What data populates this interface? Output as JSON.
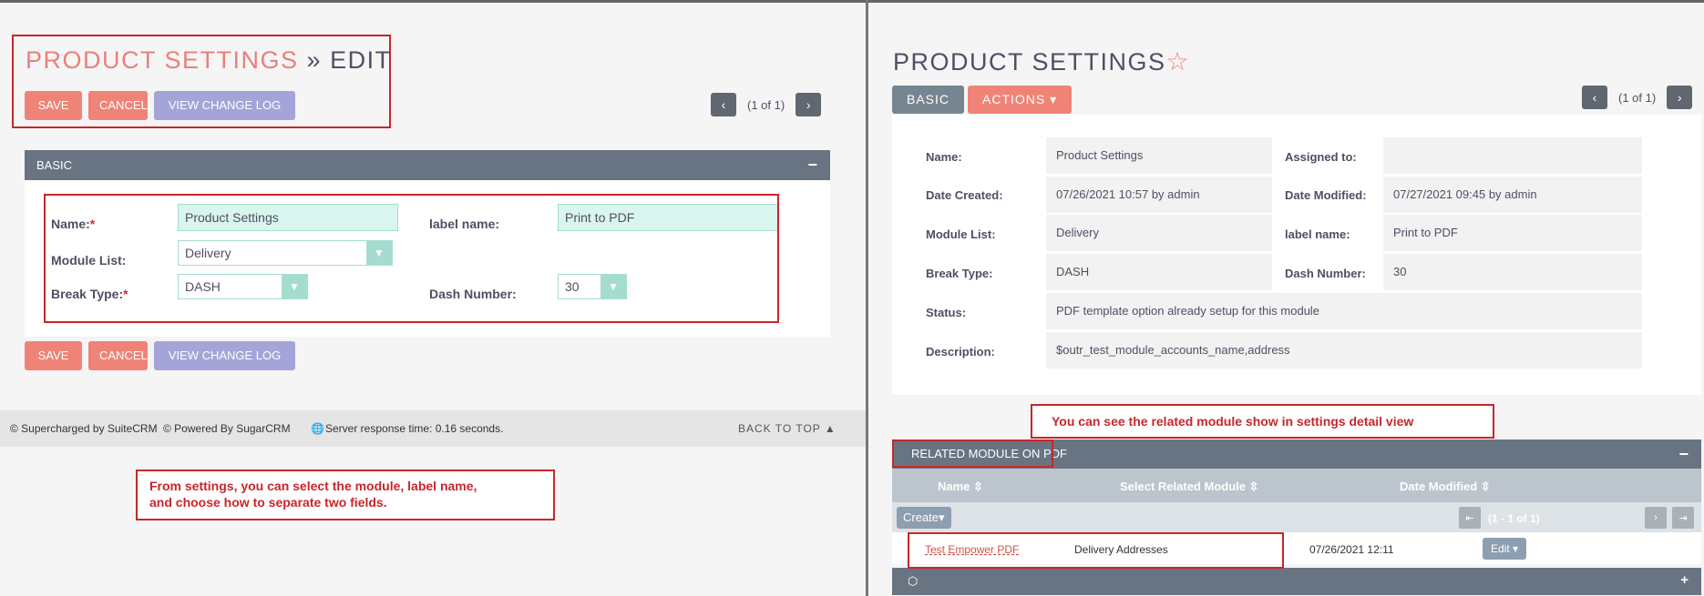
{
  "edit": {
    "title_module": "PRODUCT SETTINGS",
    "title_separator": "»",
    "title_action": "EDIT",
    "buttons": {
      "save": "SAVE",
      "cancel": "CANCEL",
      "change_log": "VIEW CHANGE LOG"
    },
    "pager": {
      "prev": "‹",
      "next": "›",
      "text": "(1 of 1)"
    },
    "panel": {
      "title": "BASIC",
      "toggle": "−"
    },
    "fields": {
      "name_label": "Name:",
      "name_value": "Product Settings",
      "label_name_label": "label name:",
      "label_name_value": "Print to PDF",
      "module_list_label": "Module List:",
      "module_list_value": "Delivery",
      "break_type_label": "Break Type:",
      "break_type_value": "DASH",
      "dash_number_label": "Dash Number:",
      "dash_number_value": "30",
      "required_mark": "*"
    }
  },
  "footer": {
    "suitecrm": "© Supercharged by SuiteCRM",
    "sugarcrm": "© Powered By SugarCRM",
    "server_time": "Server response time: 0.16 seconds.",
    "back_to_top": "BACK TO TOP ▲"
  },
  "note_left": {
    "line1": "From settings, you can select the module, label name,",
    "line2": "and choose how to separate two fields."
  },
  "detail": {
    "title": "PRODUCT SETTINGS",
    "star": "☆",
    "tabs": {
      "basic": "BASIC",
      "actions": "ACTIONS ▾"
    },
    "pager": {
      "prev": "‹",
      "next": "›",
      "text": "(1 of 1)"
    },
    "fields": {
      "name_label": "Name:",
      "name_value": "Product Settings",
      "assigned_label": "Assigned to:",
      "assigned_value": "",
      "created_label": "Date Created:",
      "created_value": "07/26/2021 10:57 by admin",
      "modified_label": "Date Modified:",
      "modified_value": "07/27/2021 09:45 by admin",
      "module_list_label": "Module List:",
      "module_list_value": "Delivery",
      "label_name_label": "label name:",
      "label_name_value": "Print to PDF",
      "break_type_label": "Break Type:",
      "break_type_value": "DASH",
      "dash_number_label": "Dash Number:",
      "dash_number_value": "30",
      "status_label": "Status:",
      "status_value": "PDF template option already setup for this module",
      "description_label": "Description:",
      "description_value": "$outr_test_module_accounts_name,address"
    }
  },
  "note_right": "You can see the related module show in settings detail view",
  "subpanel": {
    "title": "RELATED MODULE ON PDF",
    "toggle": "−",
    "columns": {
      "name": "Name ⇳",
      "related": "Select Related Module ⇳",
      "modified": "Date Modified ⇳"
    },
    "create": "Create▾",
    "count": "(1 - 1 of 1)",
    "pager": {
      "first": "⇤",
      "prev": "‹",
      "next": "›",
      "last": "⇥"
    },
    "row": {
      "name": "Test Empower PDF",
      "related": "Delivery Addresses",
      "modified": "07/26/2021 12:11",
      "edit": "Edit ▾"
    },
    "bar2_icon": "⬡",
    "bar2_toggle": "+"
  },
  "colors": {
    "accent": "#f08377",
    "panel_bar": "#687481",
    "annotation": "#c8262a",
    "purple": "#a5a4d8"
  }
}
